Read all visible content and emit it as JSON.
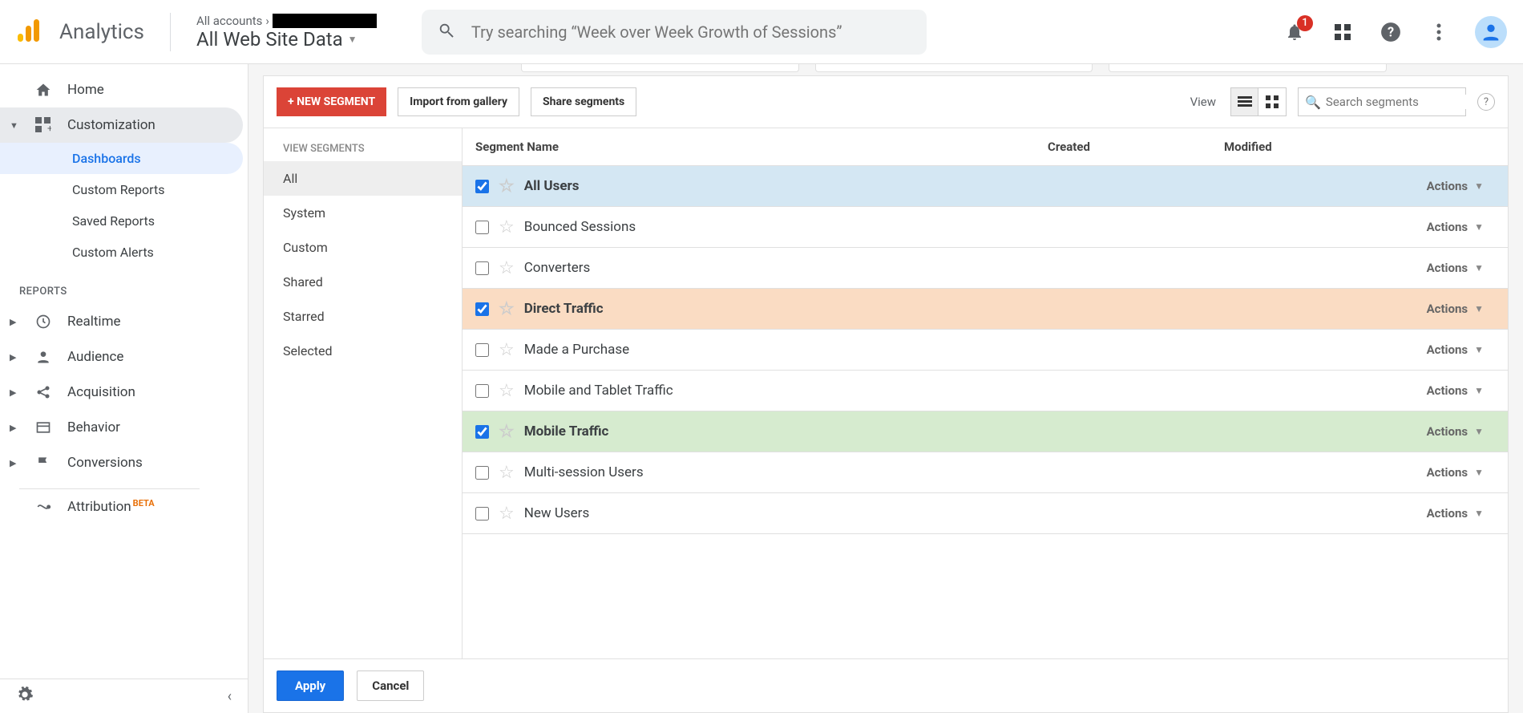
{
  "header": {
    "product": "Analytics",
    "breadcrumb_prefix": "All accounts",
    "view_name": "All Web Site Data",
    "search_placeholder": "Try searching “Week over Week Growth of Sessions”",
    "notification_count": "1"
  },
  "nav": {
    "home": "Home",
    "customization": "Customization",
    "subs": {
      "dashboards": "Dashboards",
      "custom_reports": "Custom Reports",
      "saved_reports": "Saved Reports",
      "custom_alerts": "Custom Alerts"
    },
    "reports_label": "REPORTS",
    "realtime": "Realtime",
    "audience": "Audience",
    "acquisition": "Acquisition",
    "behavior": "Behavior",
    "conversions": "Conversions",
    "attribution": "Attribution",
    "beta": "BETA"
  },
  "toolbar": {
    "new_segment": "+ NEW SEGMENT",
    "import": "Import from gallery",
    "share": "Share segments",
    "view_label": "View",
    "seg_search_placeholder": "Search segments",
    "help": "?"
  },
  "seg_side": {
    "label": "VIEW SEGMENTS",
    "cats": [
      "All",
      "System",
      "Custom",
      "Shared",
      "Starred",
      "Selected"
    ]
  },
  "table": {
    "cols": {
      "name": "Segment Name",
      "created": "Created",
      "modified": "Modified"
    },
    "actions_label": "Actions",
    "rows": [
      {
        "name": "All Users",
        "checked": true,
        "color": "blue"
      },
      {
        "name": "Bounced Sessions",
        "checked": false,
        "color": ""
      },
      {
        "name": "Converters",
        "checked": false,
        "color": ""
      },
      {
        "name": "Direct Traffic",
        "checked": true,
        "color": "orange"
      },
      {
        "name": "Made a Purchase",
        "checked": false,
        "color": ""
      },
      {
        "name": "Mobile and Tablet Traffic",
        "checked": false,
        "color": ""
      },
      {
        "name": "Mobile Traffic",
        "checked": true,
        "color": "green"
      },
      {
        "name": "Multi-session Users",
        "checked": false,
        "color": ""
      },
      {
        "name": "New Users",
        "checked": false,
        "color": ""
      }
    ]
  },
  "footer": {
    "apply": "Apply",
    "cancel": "Cancel"
  }
}
